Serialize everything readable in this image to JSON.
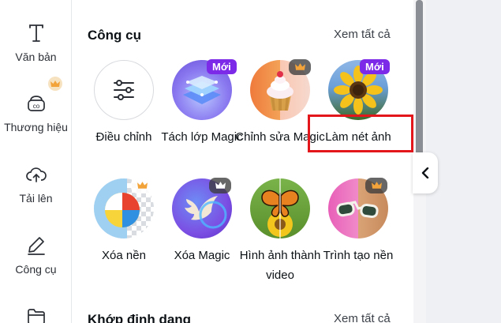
{
  "sidebar": {
    "items": [
      {
        "label": "Văn bản",
        "icon": "text-icon"
      },
      {
        "label": "Thương hiệu",
        "icon": "brand-icon"
      },
      {
        "label": "Tải lên",
        "icon": "upload-icon"
      },
      {
        "label": "Công cụ",
        "icon": "tools-icon"
      },
      {
        "label": "",
        "icon": "folder-icon"
      }
    ]
  },
  "tools_section": {
    "title": "Công cụ",
    "see_all": "Xem tất cả",
    "items": [
      {
        "label": "Điều chỉnh",
        "badge": ""
      },
      {
        "label": "Tách lớp Magic",
        "badge": "Mới"
      },
      {
        "label": "Chỉnh sửa Magic",
        "badge": "crown"
      },
      {
        "label": "Làm nét ảnh",
        "badge": "Mới"
      },
      {
        "label": "Xóa nền",
        "badge": "crown"
      },
      {
        "label": "Xóa Magic",
        "badge": "crown"
      },
      {
        "label": "Hình ảnh thành video",
        "badge": ""
      },
      {
        "label": "Trình tạo nền",
        "badge": "crown"
      }
    ]
  },
  "format_section": {
    "title": "Khớp định dạng",
    "see_all": "Xem tất cả"
  },
  "colors": {
    "accent": "#7d2ae8",
    "highlight": "#e3161c",
    "crown": "#f2a33a"
  }
}
